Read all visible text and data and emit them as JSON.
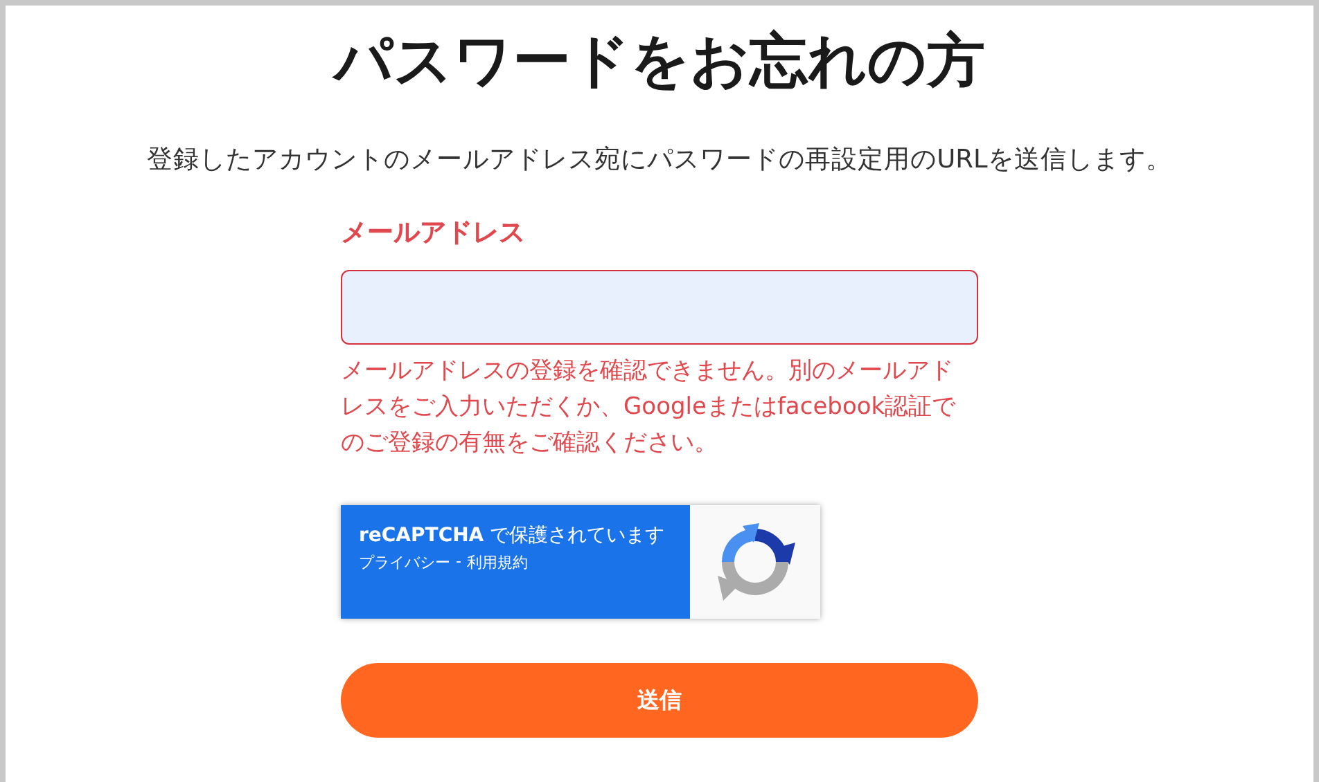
{
  "title": "パスワードをお忘れの方",
  "description": "登録したアカウントのメールアドレス宛にパスワードの再設定用のURLを送信します。",
  "email_field": {
    "label": "メールアドレス",
    "invalid": true,
    "error": "メールアドレスの登録を確認できません。別のメールアドレスをご入力いただくか、Googleまたはfacebook認証でのご登録の有無をご確認ください。"
  },
  "recaptcha": {
    "text": "**reCAPTCHA** で保護されています",
    "links": [
      "プライバシー",
      "利用規約"
    ],
    "separator": "-"
  },
  "submit_button": "送信"
}
